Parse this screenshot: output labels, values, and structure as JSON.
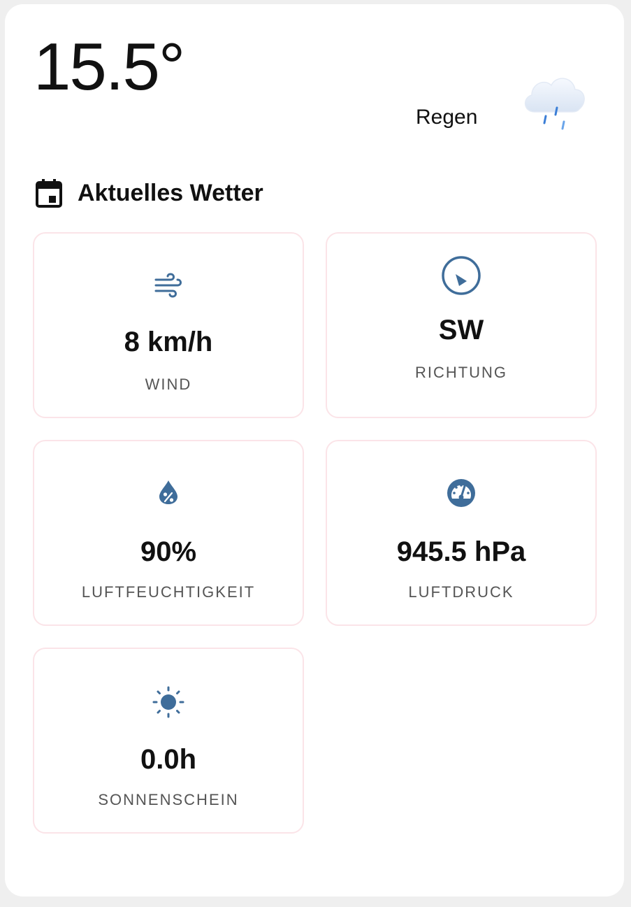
{
  "current": {
    "temperature": "15.5°",
    "condition": "Regen",
    "condition_icon": "rain-cloud-icon"
  },
  "section": {
    "title": "Aktuelles Wetter",
    "icon": "calendar-icon"
  },
  "tiles": [
    {
      "icon": "wind-icon",
      "value": "8 km/h",
      "label": "WIND"
    },
    {
      "icon": "compass-icon",
      "value": "SW",
      "label": "RICHTUNG"
    },
    {
      "icon": "humidity-icon",
      "value": "90%",
      "label": "LUFTFEUCHTIGKEIT"
    },
    {
      "icon": "gauge-icon",
      "value": "945.5 hPa",
      "label": "LUFTDRUCK"
    },
    {
      "icon": "sun-icon",
      "value": "0.0h",
      "label": "SONNENSCHEIN"
    }
  ],
  "colors": {
    "accent": "#3f6d9a",
    "tile_border": "#fbe4e8",
    "text": "#111111",
    "muted": "#555555"
  }
}
